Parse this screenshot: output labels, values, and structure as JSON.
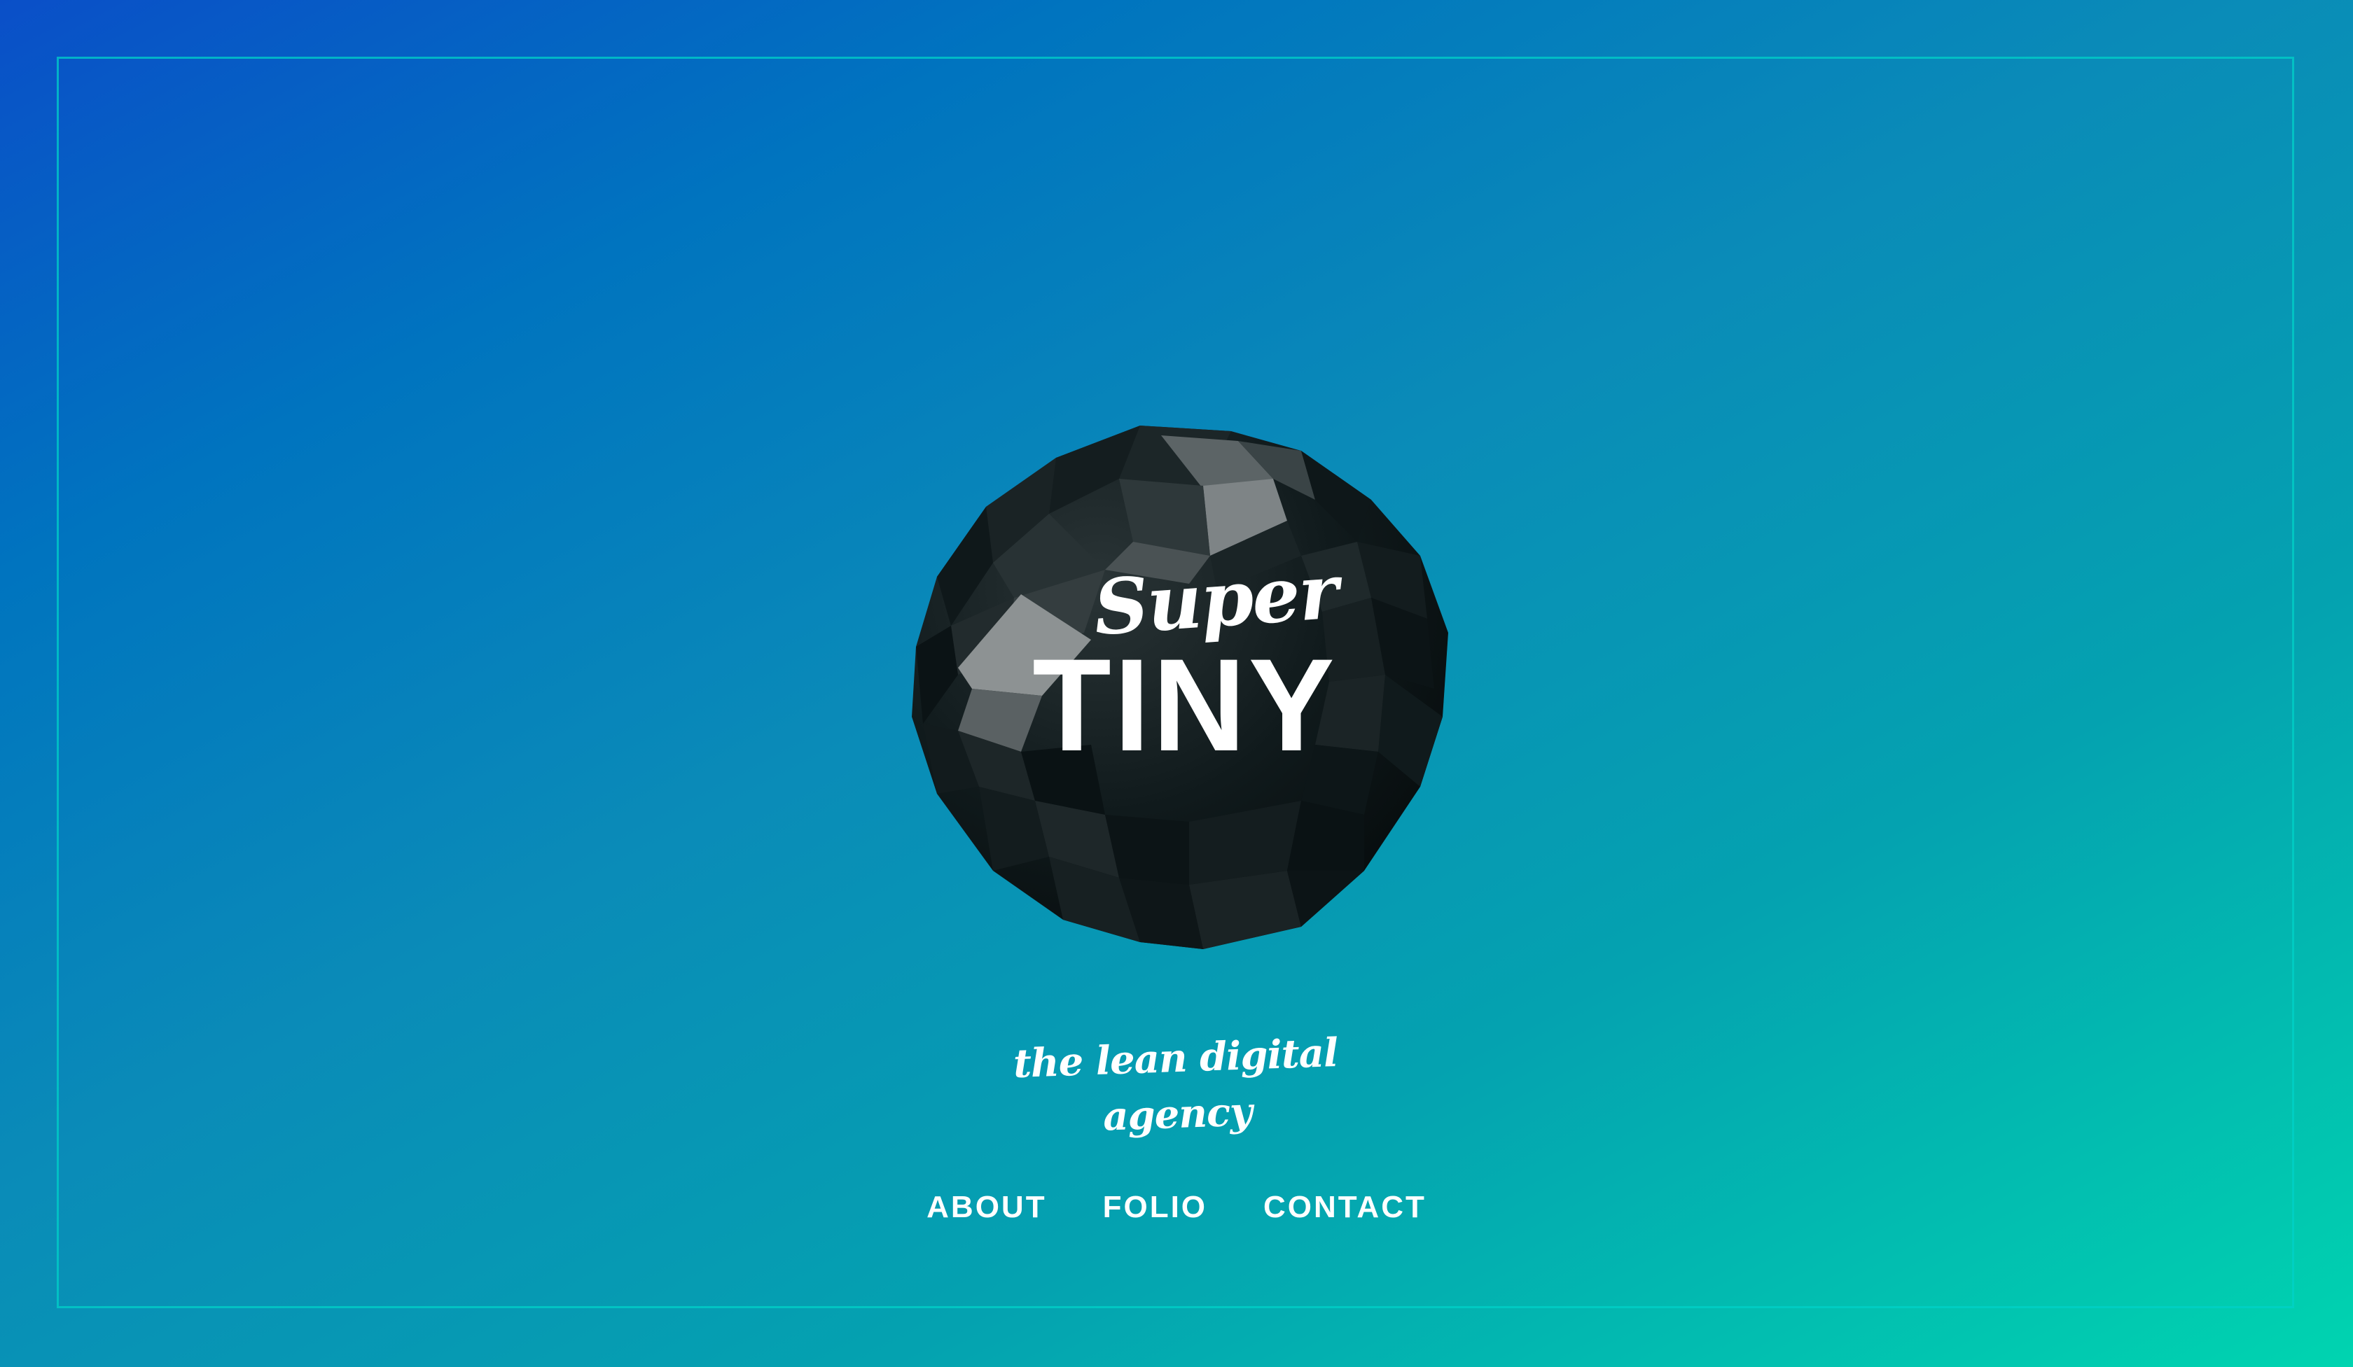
{
  "brand": {
    "logo_top": "Super",
    "logo_main": "TINY",
    "tagline": "the lean digital agency"
  },
  "nav": {
    "items": [
      {
        "label": "ABOUT"
      },
      {
        "label": "FOLIO"
      },
      {
        "label": "CONTACT"
      }
    ]
  },
  "colors": {
    "gradient_start": "#0a4fc8",
    "gradient_end": "#00d4b0",
    "frame_border": "#00d2c8",
    "orb": "#0b1417",
    "text": "#ffffff"
  },
  "icons": {
    "orb": "low-poly-sphere"
  }
}
